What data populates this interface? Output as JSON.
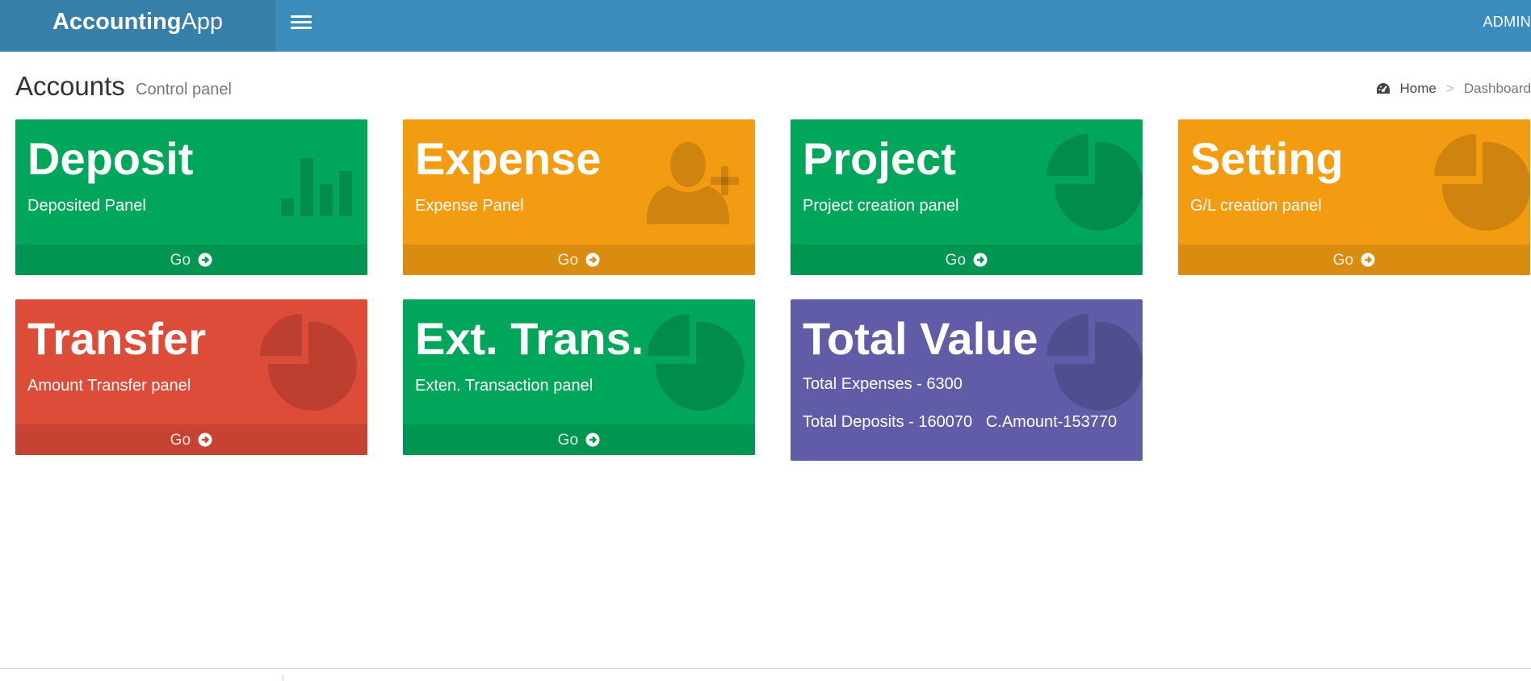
{
  "header": {
    "logo_bold": "Accounting",
    "logo_light": "App",
    "user": "ADMIN"
  },
  "page": {
    "title": "Accounts",
    "subtitle": "Control panel"
  },
  "breadcrumb": {
    "home": "Home",
    "separator": ">",
    "current": "Dashboard"
  },
  "cards": [
    {
      "title": "Deposit",
      "description": "Deposited Panel",
      "footer": "Go",
      "icon": "bar-chart-icon",
      "color": "#00a65a"
    },
    {
      "title": "Expense",
      "description": "Expense Panel",
      "footer": "Go",
      "icon": "user-plus-icon",
      "color": "#f39c12"
    },
    {
      "title": "Project",
      "description": "Project creation panel",
      "footer": "Go",
      "icon": "pie-chart-icon",
      "color": "#00a65a"
    },
    {
      "title": "Setting",
      "description": "G/L creation panel",
      "footer": "Go",
      "icon": "pie-chart-icon",
      "color": "#f39c12"
    },
    {
      "title": "Transfer",
      "description": "Amount Transfer panel",
      "footer": "Go",
      "icon": "pie-chart-icon",
      "color": "#dd4b39"
    },
    {
      "title": "Ext. Trans.",
      "description": "Exten. Transaction panel",
      "footer": "Go",
      "icon": "pie-chart-icon",
      "color": "#00a65a"
    }
  ],
  "total": {
    "title": "Total Value",
    "expenses": "Total Expenses - 6300",
    "deposits": "Total Deposits - 160070",
    "c_amount": "C.Amount-153770",
    "icon": "pie-chart-icon",
    "color": "#605ca8"
  }
}
